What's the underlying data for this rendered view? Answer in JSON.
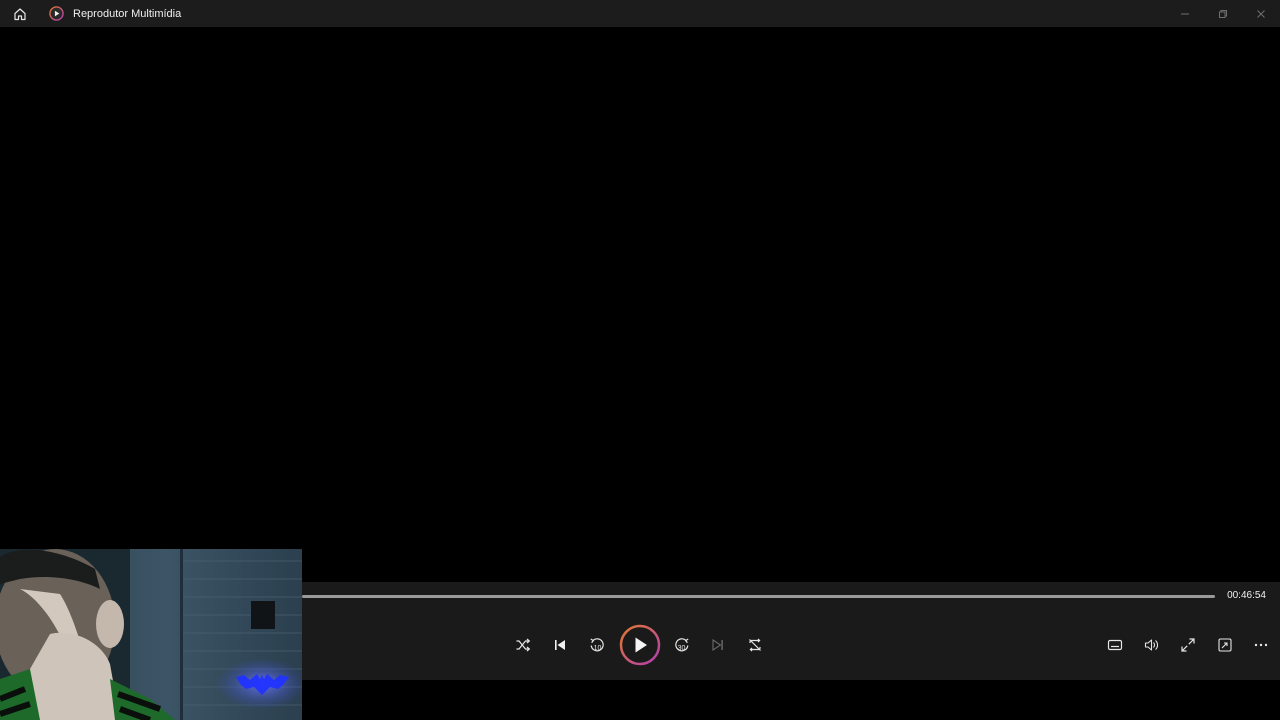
{
  "window": {
    "title": "Reprodutor Multimídia",
    "home_icon": "home-icon",
    "app_icon": "media-player-icon",
    "controls": [
      "minimize-icon",
      "restore-icon",
      "close-icon"
    ]
  },
  "player": {
    "duration": "00:46:54",
    "progress": 0,
    "transport": {
      "shuffle_icon": "shuffle-icon",
      "previous_icon": "previous-icon",
      "skip_back_icon": "skip-back-icon",
      "skip_back_seconds": "10",
      "play_icon": "play-icon",
      "skip_forward_icon": "skip-forward-icon",
      "skip_forward_seconds": "30",
      "next_icon": "next-icon",
      "repeat_icon": "repeat-off-icon"
    },
    "right_controls": [
      "subtitles-icon",
      "volume-icon",
      "fullscreen-icon",
      "mini-player-icon",
      "more-icon"
    ]
  },
  "colors": {
    "titlebar": "#1c1c1c",
    "controls_bg": "#1a1a1a",
    "play_ring_start": "#e07a2f",
    "play_ring_end": "#b23db0"
  }
}
